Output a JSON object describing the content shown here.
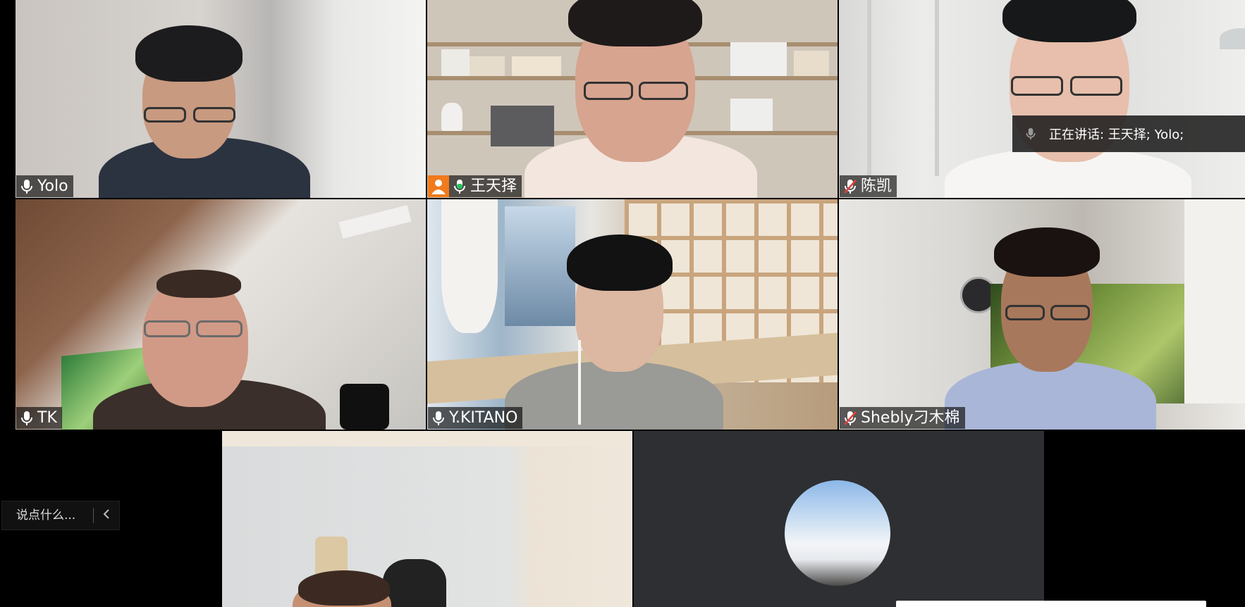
{
  "participants": [
    {
      "name": "Yolo",
      "mic": "on"
    },
    {
      "name": "王天择",
      "mic": "speaking"
    },
    {
      "name": "陈凯",
      "mic": "muted"
    },
    {
      "name": "TK",
      "mic": "on"
    },
    {
      "name": "Y.KITANO",
      "mic": "on"
    },
    {
      "name": "Shebly刁木棉",
      "mic": "muted"
    }
  ],
  "speaking_indicator": {
    "text": "正在讲话: 王天择; Yolo;"
  },
  "chat": {
    "placeholder": "说点什么...",
    "collapse_icon": "chevron-left-icon"
  },
  "colors": {
    "active_border": "#1aa54b",
    "avatar_badge": "#f07a1c",
    "muted_mic": "#e0403a"
  }
}
